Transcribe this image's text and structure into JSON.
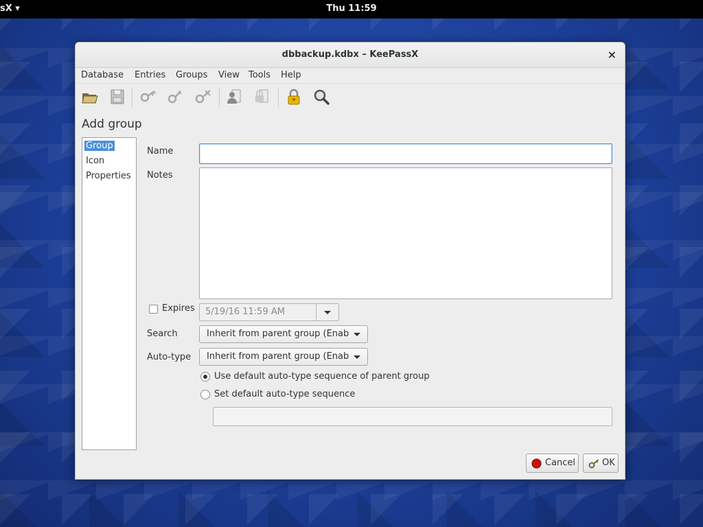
{
  "topbar": {
    "app_menu": "sX ▾",
    "clock": "Thu 11:59"
  },
  "window": {
    "title": "dbbackup.kdbx – KeePassX",
    "close_glyph": "×"
  },
  "menubar": [
    "Database",
    "Entries",
    "Groups",
    "View",
    "Tools",
    "Help"
  ],
  "toolbar": {
    "icons": [
      "open-database-icon",
      "save-database-icon",
      "new-entry-icon",
      "edit-entry-icon",
      "delete-entry-icon",
      "copy-username-icon",
      "copy-password-icon",
      "lock-database-icon",
      "search-icon"
    ]
  },
  "dialog": {
    "heading": "Add group",
    "categories": [
      "Group",
      "Icon",
      "Properties"
    ],
    "selected_category": "Group",
    "name_label": "Name",
    "name_value": "",
    "notes_label": "Notes",
    "notes_value": "",
    "expires_label": "Expires",
    "expires_checked": false,
    "expires_date": "5/19/16 11:59 AM",
    "search_label": "Search",
    "search_value": "Inherit from parent group (Enab",
    "autotype_label": "Auto-type",
    "autotype_value": "Inherit from parent group (Enab",
    "radio_default": "Use default auto-type sequence of parent group",
    "radio_set": "Set default auto-type sequence",
    "radio_selected": "default",
    "sequence_value": "",
    "cancel_label": "Cancel",
    "ok_label": "OK"
  },
  "colors": {
    "selection": "#4a90d9",
    "desktop": "#1c3f99",
    "window_bg": "#ededed"
  }
}
